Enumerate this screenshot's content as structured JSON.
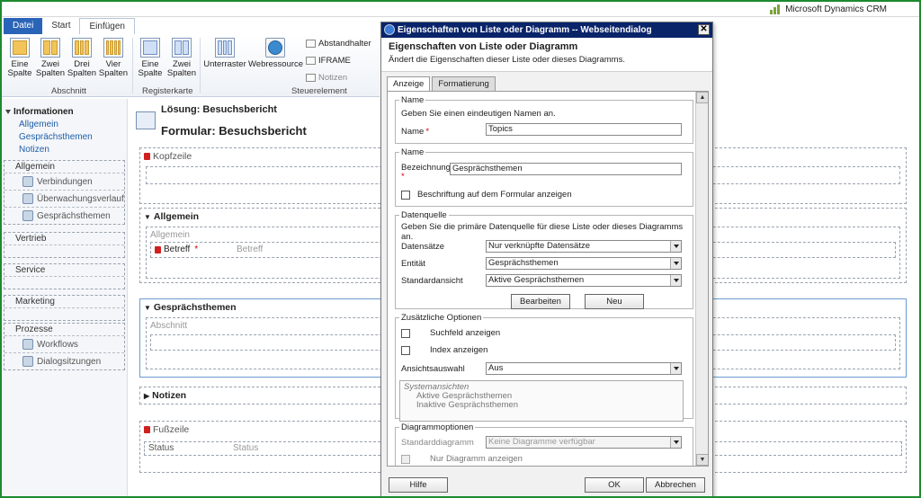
{
  "app": {
    "brand": "Microsoft Dynamics CRM"
  },
  "ribbon": {
    "tabs": [
      "Datei",
      "Start",
      "Einfügen"
    ],
    "buttons": [
      {
        "label": "Eine Spalte"
      },
      {
        "label": "Zwei Spalten"
      },
      {
        "label": "Drei Spalten"
      },
      {
        "label": "Vier Spalten"
      },
      {
        "label": "Eine Spalte"
      },
      {
        "label": "Zwei Spalten"
      },
      {
        "label": "Unterraster"
      },
      {
        "label": "Webressource"
      }
    ],
    "small_controls": [
      "Abstandhalter",
      "IFRAME",
      "Notizen"
    ],
    "groups": [
      "Abschnitt",
      "Registerkarte",
      "Steuerelement"
    ]
  },
  "leftnav": {
    "sections": [
      {
        "title": "Informationen",
        "links": [
          "Allgemein",
          "Gesprächsthemen",
          "Notizen"
        ]
      }
    ],
    "groups": [
      {
        "title": "Allgemein",
        "items": [
          "Verbindungen",
          "Überwachungsverlauf",
          "Gesprächsthemen"
        ]
      },
      {
        "title": "Vertrieb",
        "items": []
      },
      {
        "title": "Service",
        "items": []
      },
      {
        "title": "Marketing",
        "items": []
      },
      {
        "title": "Prozesse",
        "items": [
          "Workflows",
          "Dialogsitzungen"
        ]
      }
    ]
  },
  "form": {
    "solution": "Lösung: Besuchsbericht",
    "form": "Formular: Besuchsbericht",
    "sections": {
      "header": "Kopfzeile",
      "general": "Allgemein",
      "general_sub": "Allgemein",
      "subject_label": "Betreff",
      "subject_value": "Betreff",
      "topics": "Gesprächsthemen",
      "topics_sub": "Abschnitt",
      "notes": "Notizen",
      "footer": "Fußzeile",
      "status_label": "Status",
      "status_value": "Status"
    }
  },
  "dialog": {
    "title": "Eigenschaften von Liste oder Diagramm -- Webseitendialog",
    "heading": "Eigenschaften von Liste oder Diagramm",
    "subheading": "Ändert die Eigenschaften dieser Liste oder dieses Diagramms.",
    "tabs": [
      "Anzeige",
      "Formatierung"
    ],
    "name_section": {
      "legend": "Name",
      "hint": "Geben Sie einen eindeutigen Namen an.",
      "label": "Name",
      "value": "Topics"
    },
    "label_section": {
      "legend": "Name",
      "label": "Bezeichnung",
      "value": "Gesprächsthemen",
      "checkbox": "Beschriftung auf dem Formular anzeigen"
    },
    "datasource": {
      "legend": "Datenquelle",
      "hint": "Geben Sie die primäre Datenquelle für diese Liste oder dieses Diagramms an.",
      "records_label": "Datensätze",
      "records_value": "Nur verknüpfte Datensätze",
      "entity_label": "Entität",
      "entity_value": "Gesprächsthemen",
      "default_view_label": "Standardansicht",
      "default_view_value": "Aktive Gesprächsthemen",
      "edit_button": "Bearbeiten",
      "new_button": "Neu"
    },
    "options": {
      "legend": "Zusätzliche Optionen",
      "search": "Suchfeld anzeigen",
      "index": "Index anzeigen",
      "view_select_label": "Ansichtsauswahl",
      "view_select_value": "Aus",
      "views_header": "Systemansichten",
      "views": [
        "Aktive Gesprächsthemen",
        "Inaktive Gesprächsthemen"
      ]
    },
    "chart": {
      "legend": "Diagrammoptionen",
      "default_label": "Standarddiagramm",
      "default_value": "Keine Diagramme verfügbar",
      "only_chart": "Nur Diagramm anzeigen"
    },
    "buttons": {
      "help": "Hilfe",
      "ok": "OK",
      "cancel": "Abbrechen"
    }
  }
}
